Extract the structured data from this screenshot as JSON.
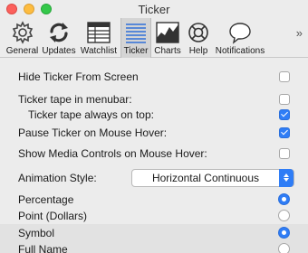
{
  "window": {
    "title": "Ticker"
  },
  "toolbar": {
    "items": [
      {
        "label": "General",
        "icon": "gear-icon"
      },
      {
        "label": "Updates",
        "icon": "refresh-icon"
      },
      {
        "label": "Watchlist",
        "icon": "grid-icon"
      },
      {
        "label": "Ticker",
        "icon": "ticker-lines-icon",
        "selected": true
      },
      {
        "label": "Charts",
        "icon": "chart-icon"
      },
      {
        "label": "Help",
        "icon": "lifebuoy-icon"
      },
      {
        "label": "Notifications",
        "icon": "speech-bubble-icon"
      }
    ],
    "more": "»"
  },
  "settings": {
    "hide_ticker": {
      "label": "Hide Ticker From Screen",
      "checked": false
    },
    "tape_menubar": {
      "label": "Ticker tape in menubar:",
      "checked": false
    },
    "tape_ontop": {
      "label": "Ticker tape always on top:",
      "checked": true
    },
    "pause_hover": {
      "label": "Pause Ticker on Mouse Hover:",
      "checked": true
    },
    "media_hover": {
      "label": "Show Media Controls on Mouse Hover:",
      "checked": false
    },
    "animation": {
      "label": "Animation Style:",
      "value": "Horizontal Continuous"
    },
    "percentage": {
      "label": "Percentage",
      "selected": true
    },
    "point": {
      "label": "Point (Dollars)",
      "selected": false
    },
    "symbol": {
      "label": "Symbol",
      "selected": true
    },
    "fullname": {
      "label": "Full Name",
      "selected": false
    }
  },
  "colors": {
    "accent": "#2f7df6",
    "close": "#fc605c",
    "minimize": "#fdbc40",
    "maximize": "#34c84a"
  }
}
